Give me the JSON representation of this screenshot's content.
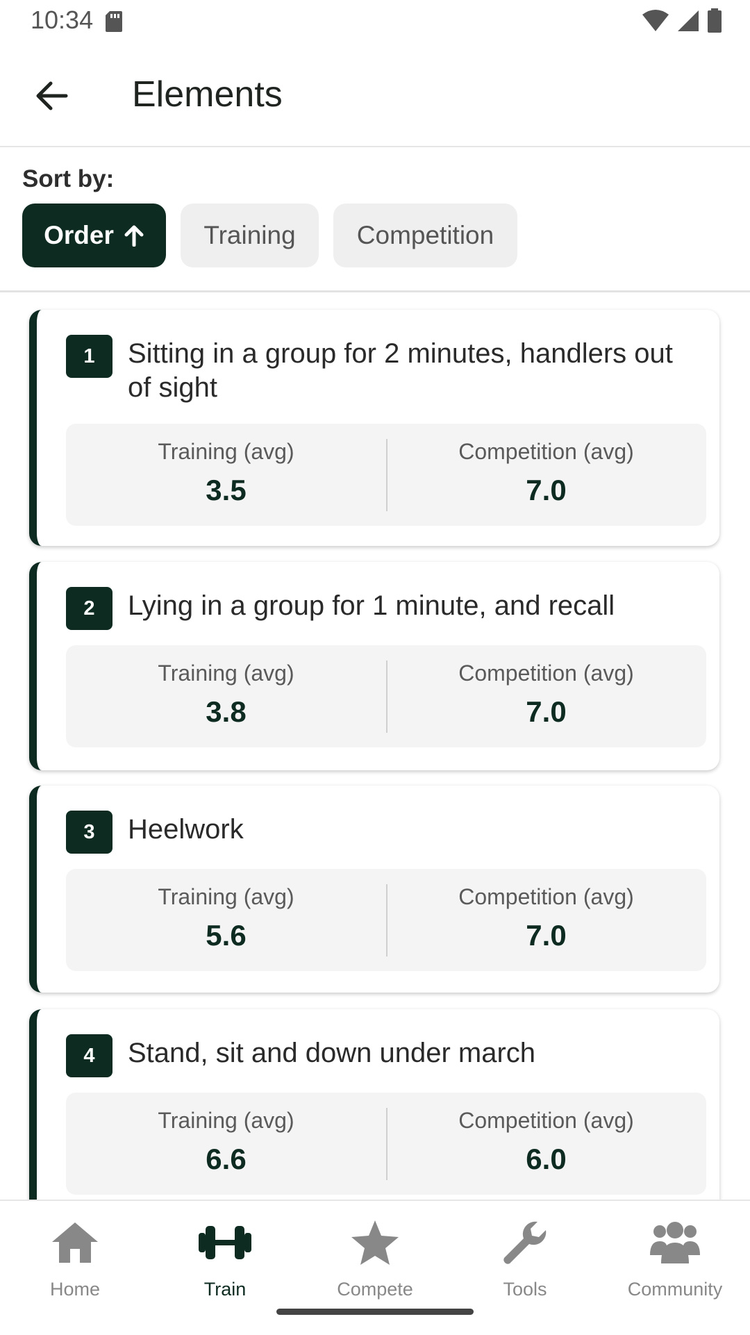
{
  "status_bar": {
    "time": "10:34"
  },
  "header": {
    "title": "Elements"
  },
  "sort": {
    "label": "Sort by:",
    "options": [
      {
        "label": "Order",
        "selected": true,
        "direction": "ascending",
        "icon": "arrow-up-icon"
      },
      {
        "label": "Training",
        "selected": false
      },
      {
        "label": "Competition",
        "selected": false
      }
    ]
  },
  "elements": [
    {
      "number": "1",
      "title": "Sitting in a group for 2 minutes, handlers out of sight",
      "training_label": "Training (avg)",
      "training_value": "3.5",
      "competition_label": "Competition (avg)",
      "competition_value": "7.0"
    },
    {
      "number": "2",
      "title": "Lying in a group for 1 minute, and recall",
      "training_label": "Training (avg)",
      "training_value": "3.8",
      "competition_label": "Competition (avg)",
      "competition_value": "7.0"
    },
    {
      "number": "3",
      "title": "Heelwork",
      "training_label": "Training (avg)",
      "training_value": "5.6",
      "competition_label": "Competition (avg)",
      "competition_value": "7.0"
    },
    {
      "number": "4",
      "title": "Stand, sit and down under march",
      "training_label": "Training (avg)",
      "training_value": "6.6",
      "competition_label": "Competition (avg)",
      "competition_value": "6.0"
    }
  ],
  "bottom_nav": [
    {
      "label": "Home",
      "icon": "home-icon",
      "active": false
    },
    {
      "label": "Train",
      "icon": "dumbbell-icon",
      "active": true
    },
    {
      "label": "Compete",
      "icon": "star-icon",
      "active": false
    },
    {
      "label": "Tools",
      "icon": "wrench-icon",
      "active": false
    },
    {
      "label": "Community",
      "icon": "users-icon",
      "active": false
    }
  ],
  "colors": {
    "primary": "#0d2b20",
    "chip_inactive": "#efefef",
    "stats_bg": "#f4f4f4",
    "nav_inactive": "#888888"
  }
}
